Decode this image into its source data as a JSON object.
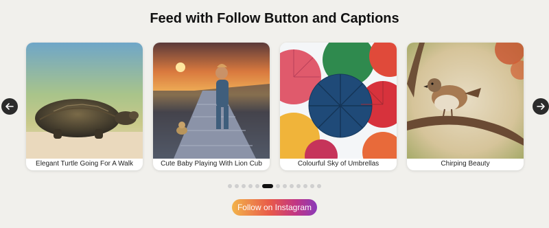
{
  "header": {
    "title": "Feed with Follow Button and Captions"
  },
  "carousel": {
    "prev_icon": "arrow-left-icon",
    "next_icon": "arrow-right-icon",
    "items": [
      {
        "caption": "Elegant Turtle Going For A Walk"
      },
      {
        "caption": "Cute Baby Playing With Lion Cub"
      },
      {
        "caption": "Colourful Sky of Umbrellas"
      },
      {
        "caption": "Chirping Beauty"
      }
    ],
    "dots": {
      "count": 13,
      "active_index": 5
    }
  },
  "follow_button": {
    "label": "Follow on Instagram"
  },
  "colors": {
    "background": "#f1f0ec",
    "arrow": "#2b2b2b",
    "dot_inactive": "#cfcfcf",
    "dot_active": "#111111",
    "gradient": [
      "#f2b34a",
      "#e8594a",
      "#c13584",
      "#8a3ab9"
    ]
  }
}
